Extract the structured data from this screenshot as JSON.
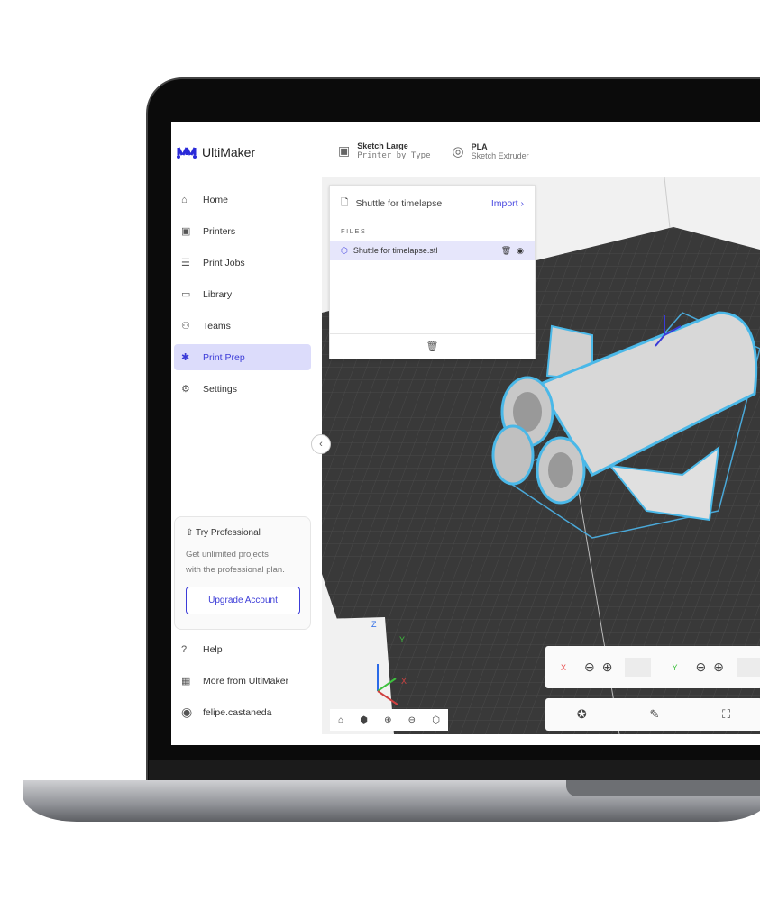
{
  "brand": {
    "name": "UltiMaker",
    "accent": "#3c3cd8"
  },
  "topbar": {
    "printer": {
      "title": "Sketch Large",
      "sub": "Printer by Type"
    },
    "material": {
      "title": "PLA",
      "sub": "Sketch Extruder"
    }
  },
  "nav": [
    {
      "label": "Home",
      "icon": "home-icon"
    },
    {
      "label": "Printers",
      "icon": "printer-icon"
    },
    {
      "label": "Print Jobs",
      "icon": "print-jobs-icon"
    },
    {
      "label": "Library",
      "icon": "library-icon"
    },
    {
      "label": "Teams",
      "icon": "teams-icon"
    },
    {
      "label": "Print Prep",
      "icon": "print-prep-icon",
      "active": true
    },
    {
      "label": "Settings",
      "icon": "gear-icon"
    }
  ],
  "promo": {
    "title": "Try Professional",
    "text1": "Get unlimited projects",
    "text2": "with the professional plan.",
    "button": "Upgrade Account"
  },
  "bottom_nav": [
    {
      "label": "Help",
      "icon": "help-icon"
    },
    {
      "label": "More from UltiMaker",
      "icon": "grid-icon"
    },
    {
      "label": "felipe.castaneda",
      "icon": "user-icon"
    }
  ],
  "panel": {
    "project": "Shuttle for timelapse",
    "import": "Import",
    "files_label": "FILES",
    "file": "Shuttle for timelapse.stl"
  },
  "controls": {
    "x_label": "X",
    "y_label": "Y",
    "x_color": "#e84a4a",
    "y_color": "#3ec13e"
  },
  "axes": {
    "x": "X",
    "y": "Y",
    "z": "Z"
  }
}
